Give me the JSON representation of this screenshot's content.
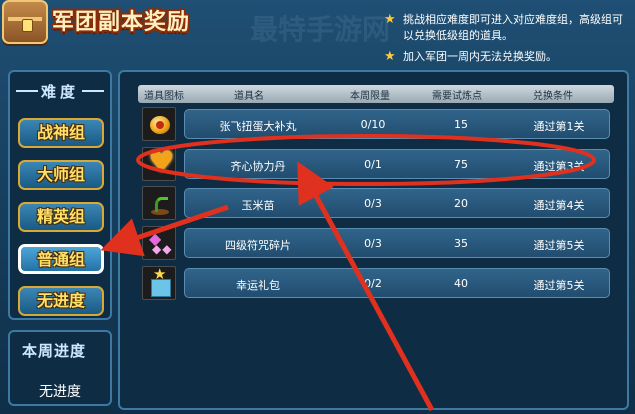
{
  "header": {
    "title": "军团副本奖励",
    "watermark": "最特手游网",
    "notes": [
      "挑战相应难度即可进入对应难度组，高级组可以兑换低级组的道具。",
      "加入军团一周内无法兑换奖励。"
    ]
  },
  "sidebar": {
    "title": "难度",
    "buttons": [
      {
        "label": "战神组"
      },
      {
        "label": "大师组"
      },
      {
        "label": "精英组"
      },
      {
        "label": "普通组"
      },
      {
        "label": "无进度"
      }
    ],
    "active_index": 3
  },
  "progress": {
    "title": "本周进度",
    "value": "无进度"
  },
  "table": {
    "headers": {
      "icon": "道具图标",
      "name": "道具名",
      "limit": "本周限量",
      "points": "需要试炼点",
      "condition": "兑换条件"
    },
    "rows": [
      {
        "icon": "dumpling-icon",
        "name": "张飞扭蛋大补丸",
        "limit": "0/10",
        "points": "15",
        "condition": "通过第1关"
      },
      {
        "icon": "heart-pill-icon",
        "name": "齐心协力丹",
        "limit": "0/1",
        "points": "75",
        "condition": "通过第3关"
      },
      {
        "icon": "sprout-icon",
        "name": "玉米苗",
        "limit": "0/3",
        "points": "20",
        "condition": "通过第4关"
      },
      {
        "icon": "curse-shard-icon",
        "name": "四级符咒碎片",
        "limit": "0/3",
        "points": "35",
        "condition": "通过第5关"
      },
      {
        "icon": "gift-box-icon",
        "name": "幸运礼包",
        "limit": "0/2",
        "points": "40",
        "condition": "通过第5关"
      }
    ]
  },
  "colors": {
    "background": "#17405f",
    "accent_gold": "#ffe06a",
    "annotation_red": "#e0301e"
  }
}
